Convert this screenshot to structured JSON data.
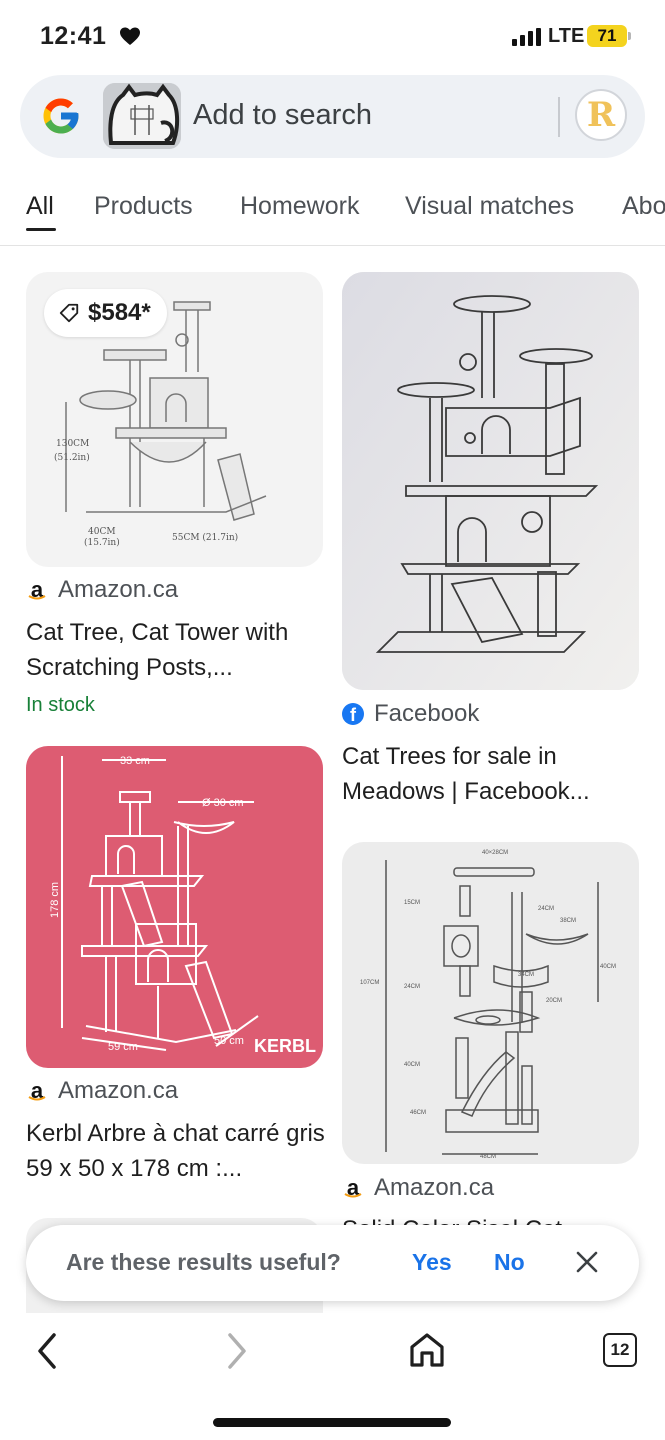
{
  "status_bar": {
    "time": "12:41",
    "network": "LTE",
    "battery": "71"
  },
  "search": {
    "placeholder": "Add to search",
    "avatar_letter": "R"
  },
  "tabs": [
    {
      "label": "All",
      "active": true
    },
    {
      "label": "Products",
      "active": false
    },
    {
      "label": "Homework",
      "active": false
    },
    {
      "label": "Visual matches",
      "active": false
    },
    {
      "label": "Abo",
      "active": false
    }
  ],
  "results": [
    {
      "price": "$584*",
      "source": "Amazon.ca",
      "source_icon": "amazon-icon",
      "title": "Cat Tree, Cat Tower with Scratching Posts,...",
      "stock": "In stock",
      "diagram_labels": [
        "130CM",
        "(51.2in)",
        "40CM",
        "(15.7in)",
        "55CM (21.7in)"
      ]
    },
    {
      "source": "Facebook",
      "source_icon": "facebook-icon",
      "title": "Cat Trees for sale in Meadows | Facebook..."
    },
    {
      "source": "Amazon.ca",
      "source_icon": "amazon-icon",
      "title": "Kerbl Arbre à chat carré gris 59 x 50 x 178 cm :...",
      "diagram_labels": [
        "33 cm",
        "Ø 30 cm",
        "178 cm",
        "59 cm",
        "50 cm",
        "KERBL"
      ]
    },
    {
      "source": "Amazon.ca",
      "source_icon": "amazon-icon",
      "title": "Solid Color Sisal Cat..."
    }
  ],
  "feedback": {
    "question": "Are these results useful?",
    "yes": "Yes",
    "no": "No"
  },
  "bottom_nav": {
    "tab_count": "12"
  },
  "colors": {
    "accent_blue": "#1a73e8",
    "stock_green": "#188038",
    "pink_card": "#dd5c72",
    "battery_yellow": "#f4d31e"
  }
}
